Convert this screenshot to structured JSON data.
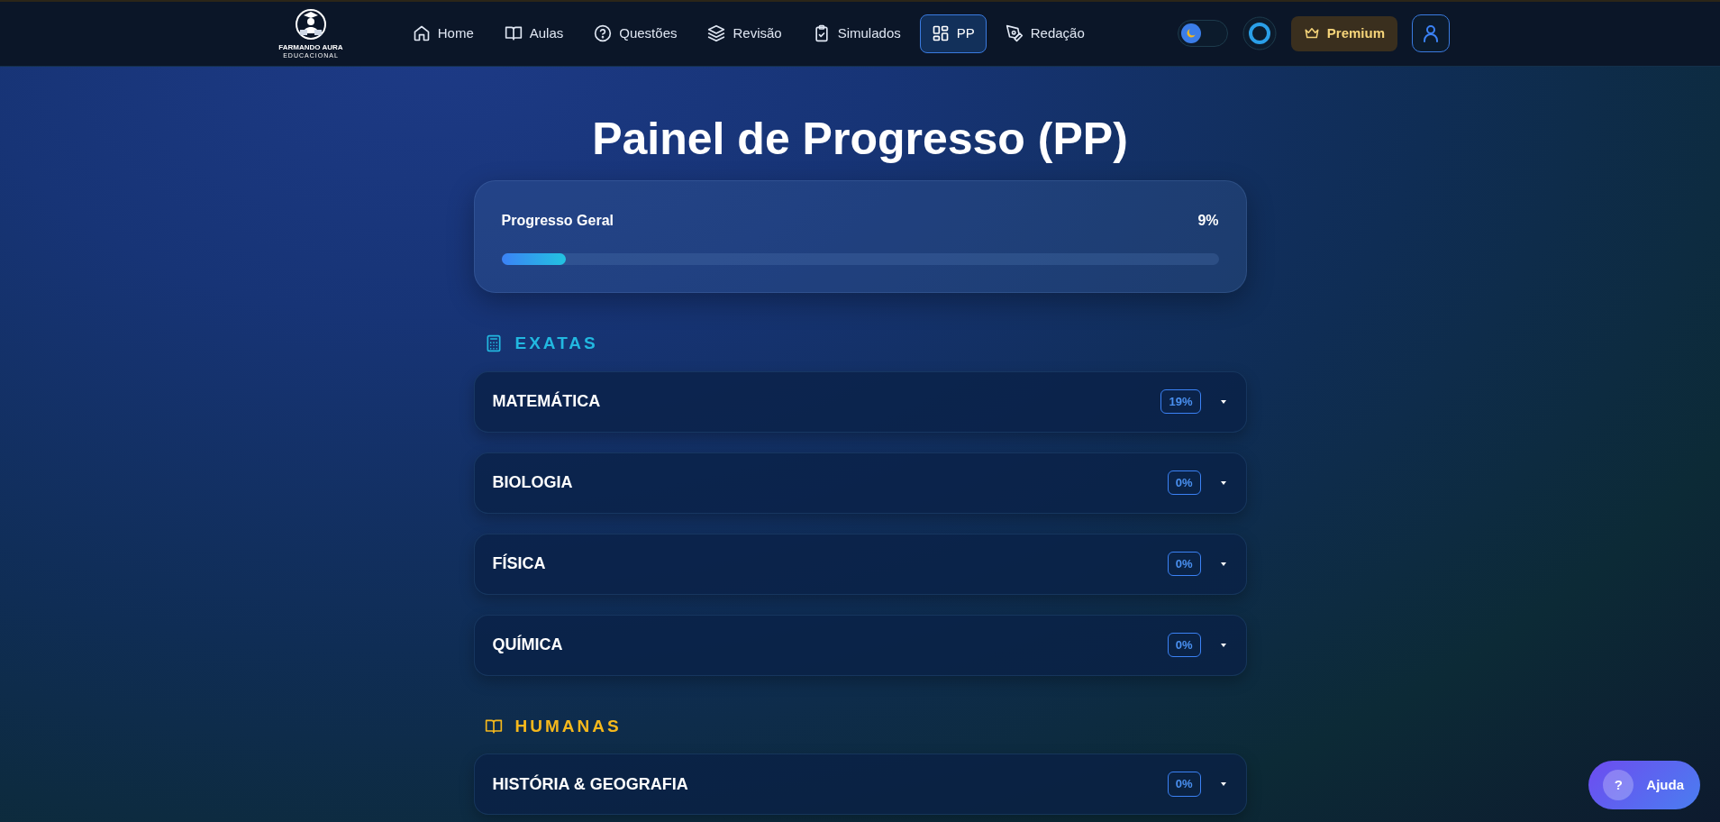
{
  "brand": {
    "name": "FARMANDO AURA",
    "tagline": "EDUCACIONAL"
  },
  "nav": [
    {
      "label": "Home",
      "selected": false
    },
    {
      "label": "Aulas",
      "selected": false
    },
    {
      "label": "Questões",
      "selected": false
    },
    {
      "label": "Revisão",
      "selected": false
    },
    {
      "label": "Simulados",
      "selected": false
    },
    {
      "label": "PP",
      "selected": true
    },
    {
      "label": "Redação",
      "selected": false
    }
  ],
  "theme_toggle": {
    "on": false
  },
  "premium_button": "Premium",
  "title": "Painel de Progresso (PP)",
  "overall": {
    "label": "Progresso Geral",
    "reading": "9%",
    "level": 0.09
  },
  "sections": [
    {
      "title": "EXATAS",
      "color": "#22b8e0",
      "subjects": [
        {
          "name": "MATEMÁTICA",
          "percent": "19%",
          "expanded": false
        },
        {
          "name": "BIOLOGIA",
          "percent": "0%",
          "expanded": false
        },
        {
          "name": "FÍSICA",
          "percent": "0%",
          "expanded": false
        },
        {
          "name": "QUÍMICA",
          "percent": "0%",
          "expanded": false
        }
      ]
    },
    {
      "title": "HUMANAS",
      "color": "#f5b81c",
      "subjects": [
        {
          "name": "HISTÓRIA & GEOGRAFIA",
          "percent": "0%",
          "expanded": false
        }
      ]
    }
  ],
  "help_button": {
    "icon_text": "?",
    "label": "Ajuda"
  }
}
